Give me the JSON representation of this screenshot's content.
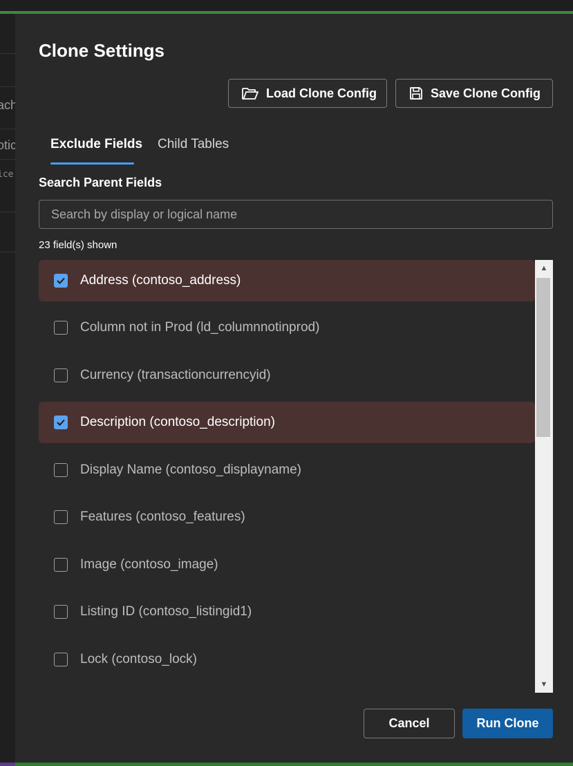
{
  "dialog": {
    "title": "Clone Settings",
    "load_button": "Load Clone Config",
    "save_button": "Save Clone Config",
    "tabs": [
      {
        "label": "Exclude Fields",
        "active": true
      },
      {
        "label": "Child Tables",
        "active": false
      }
    ],
    "section_label": "Search Parent Fields",
    "search": {
      "placeholder": "Search by display or logical name",
      "value": ""
    },
    "count_text": "23 field(s) shown",
    "fields": [
      {
        "label": "Address (contoso_address)",
        "checked": true
      },
      {
        "label": "Column not in Prod (ld_columnnotinprod)",
        "checked": false
      },
      {
        "label": "Currency (transactioncurrencyid)",
        "checked": false
      },
      {
        "label": "Description (contoso_description)",
        "checked": true
      },
      {
        "label": "Display Name (contoso_displayname)",
        "checked": false
      },
      {
        "label": "Features (contoso_features)",
        "checked": false
      },
      {
        "label": "Image (contoso_image)",
        "checked": false
      },
      {
        "label": "Listing ID (contoso_listingid1)",
        "checked": false
      },
      {
        "label": "Lock (contoso_lock)",
        "checked": false
      }
    ],
    "cancel_button": "Cancel",
    "run_button": "Run Clone"
  },
  "background_fragments": {
    "frag1": "ach",
    "frag2": "otic",
    "frag3": "ice"
  },
  "colors": {
    "accent": "#479ef5",
    "primary_button": "#115ea3",
    "checked_row": "#4a3230",
    "checkbox_checked": "#5aa3ee"
  },
  "icons": {
    "load": "folder-open-icon",
    "save": "save-icon",
    "checkbox": "checkmark-icon"
  }
}
